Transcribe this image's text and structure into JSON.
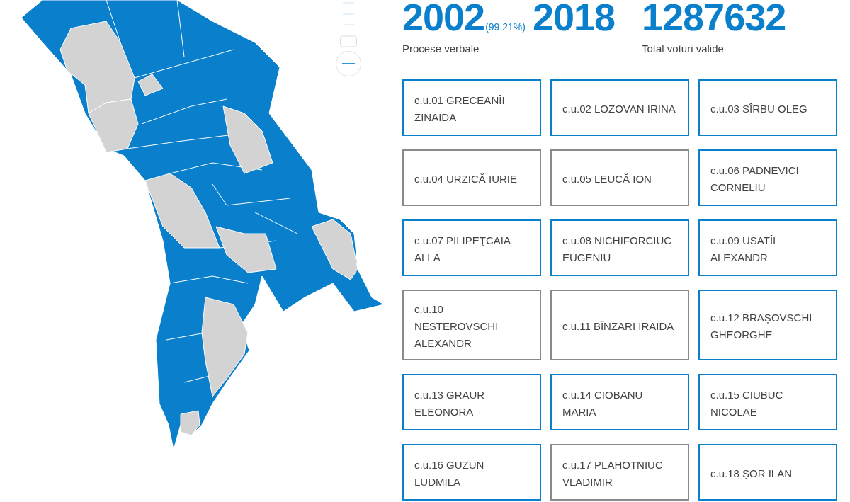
{
  "stats": {
    "counted": "2002",
    "share": "(99.21%)",
    "expected": "2018",
    "label": "Procese verbale"
  },
  "votes": {
    "total": "1287632",
    "label": "Total voturi valide"
  },
  "candidates": [
    {
      "label": "c.u.01 GRECEANÎI ZINAIDA",
      "selected": true
    },
    {
      "label": "c.u.02 LOZOVAN IRINA",
      "selected": true
    },
    {
      "label": "c.u.03 SÎRBU OLEG",
      "selected": true
    },
    {
      "label": "c.u.04 URZICĂ IURIE",
      "selected": false
    },
    {
      "label": "c.u.05 LEUCĂ ION",
      "selected": false
    },
    {
      "label": "c.u.06 PADNEVICI CORNELIU",
      "selected": true
    },
    {
      "label": "c.u.07 PILIPEŢCAIA ALLA",
      "selected": true
    },
    {
      "label": "c.u.08 NICHIFORCIUC EUGENIU",
      "selected": true
    },
    {
      "label": "c.u.09 USATÎI ALEXANDR",
      "selected": true
    },
    {
      "label": "c.u.10 NESTEROVSCHI ALEXANDR",
      "selected": false
    },
    {
      "label": "c.u.11 BÎNZARI IRAIDA",
      "selected": false
    },
    {
      "label": "c.u.12 BRAȘOVSCHI GHEORGHE",
      "selected": true
    },
    {
      "label": "c.u.13 GRAUR ELEONORA",
      "selected": true
    },
    {
      "label": "c.u.14 CIOBANU MARIA",
      "selected": true
    },
    {
      "label": "c.u.15 CIUBUC NICOLAE",
      "selected": true
    },
    {
      "label": "c.u.16 GUZUN LUDMILA",
      "selected": true
    },
    {
      "label": "c.u.17 PLAHOTNIUC VLADIMIR",
      "selected": false
    },
    {
      "label": "c.u.18 ȘOR ILAN",
      "selected": true
    }
  ]
}
